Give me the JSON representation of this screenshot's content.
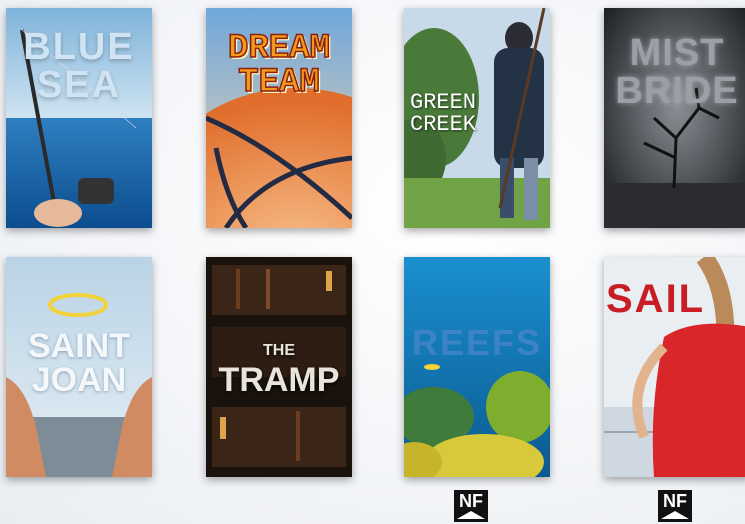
{
  "books": [
    {
      "id": "blue-sea",
      "title": "BLUE SEA"
    },
    {
      "id": "dream-team",
      "title": "DREAM TEAM"
    },
    {
      "id": "green-creek",
      "title": "GREEN CREEK"
    },
    {
      "id": "mist-bride",
      "title": "MIST BRIDE"
    },
    {
      "id": "saint-joan",
      "title": "SAINT JOAN"
    },
    {
      "id": "the-tramp",
      "title_small": "THE",
      "title": "TRAMP"
    },
    {
      "id": "reefs",
      "title": "REEFS"
    },
    {
      "id": "sail",
      "title": "SAIL"
    }
  ],
  "badges": [
    {
      "label": "NF"
    },
    {
      "label": "NF"
    }
  ],
  "colors": {
    "background": "#f3f5f8",
    "badge": "#111111"
  }
}
